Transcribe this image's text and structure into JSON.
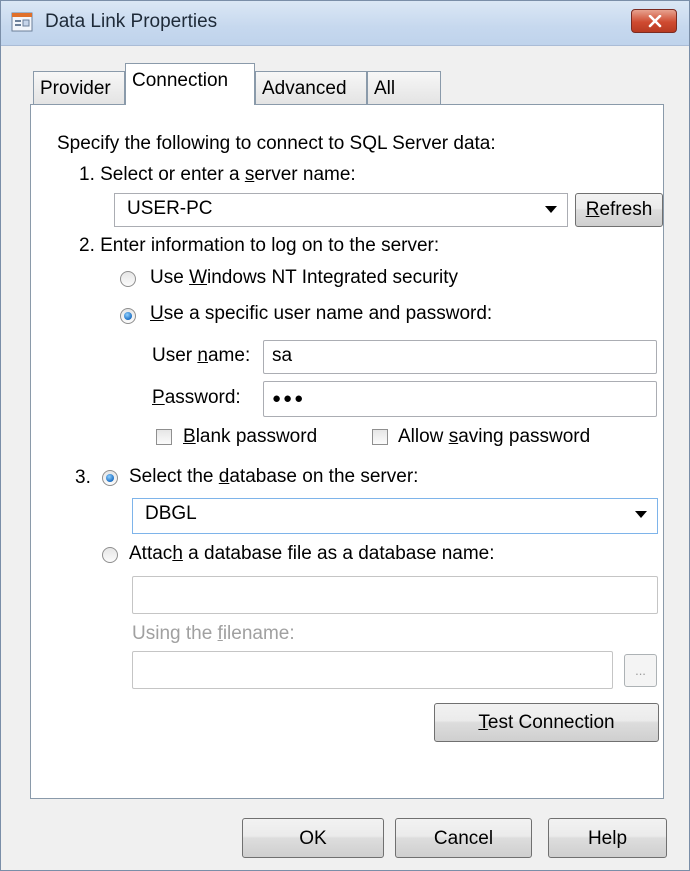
{
  "window": {
    "title": "Data Link Properties"
  },
  "tabs": [
    {
      "label": "Provider",
      "active": false
    },
    {
      "label": "Connection",
      "active": true
    },
    {
      "label": "Advanced",
      "active": false
    },
    {
      "label": "All",
      "active": false
    }
  ],
  "connection": {
    "intro": "Specify the following to connect to SQL Server data:",
    "step1": {
      "pre": "1. Select or enter a ",
      "key": "s",
      "post": "erver name:",
      "server_value": "USER-PC",
      "refresh": {
        "key": "R",
        "rest": "efresh"
      }
    },
    "step2": {
      "label": "2. Enter information to log on to the server:",
      "windows_nt": {
        "pre": "Use ",
        "key": "W",
        "post": "indows NT Integrated security",
        "checked": false
      },
      "specific": {
        "pre": "",
        "key": "U",
        "post": "se a specific user name and password:",
        "checked": true
      },
      "user_name": {
        "pre": "User ",
        "key": "n",
        "post": "ame:",
        "value": "sa"
      },
      "password": {
        "pre": "",
        "key": "P",
        "post": "assword:",
        "value": "●●●"
      },
      "blank_password": {
        "pre": "",
        "key": "B",
        "post": "lank password",
        "checked": false
      },
      "allow_saving": {
        "pre": "Allow ",
        "key": "s",
        "post": "aving password",
        "checked": false
      }
    },
    "step3": {
      "number": "3.",
      "select_db": {
        "pre": "Select the ",
        "key": "d",
        "post": "atabase on the server:",
        "checked": true
      },
      "database_value": "DBGL",
      "attach": {
        "pre": "Attac",
        "key": "h",
        "post": " a database file as a database name:",
        "checked": false
      },
      "attach_value": "",
      "using_filename": {
        "pre": "Using the ",
        "key": "f",
        "post": "ilename:"
      },
      "filename_value": "",
      "browse_label": "..."
    },
    "test_connection": {
      "key": "T",
      "rest": "est Connection"
    }
  },
  "footer": {
    "ok": "OK",
    "cancel": "Cancel",
    "help": "Help"
  }
}
